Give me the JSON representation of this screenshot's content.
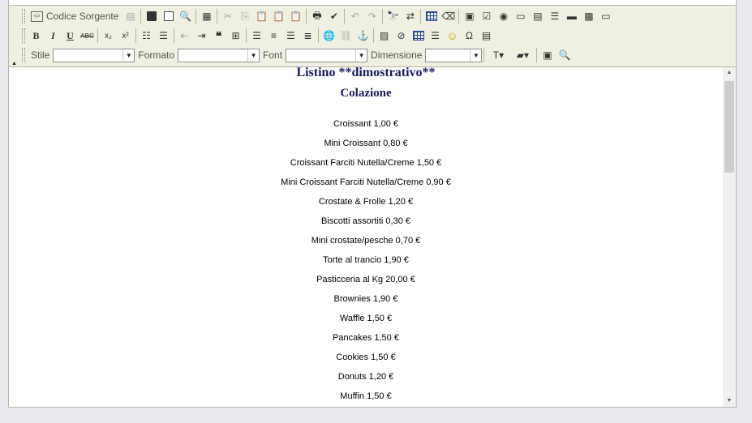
{
  "toolbar": {
    "source_label": "Codice Sorgente",
    "row1_icons": [
      "paste-word-icon",
      "save-icon",
      "new-page-icon",
      "preview-icon",
      "templates-icon",
      "cut-icon",
      "copy-icon",
      "paste-icon",
      "paste-text-icon",
      "paste-word-icon",
      "print-icon",
      "spellcheck-icon",
      "undo-icon",
      "redo-icon",
      "find-icon",
      "replace-icon",
      "select-all-icon",
      "remove-format-icon",
      "form-icon",
      "checkbox-icon",
      "radio-icon",
      "textfield-icon",
      "textarea-icon",
      "select-field-icon",
      "button-field-icon",
      "image-button-icon",
      "hidden-field-icon"
    ],
    "row2_icons": [
      "bold-icon",
      "italic-icon",
      "underline-icon",
      "strikethrough-icon",
      "subscript-icon",
      "superscript-icon",
      "numbered-list-icon",
      "bullet-list-icon",
      "outdent-icon",
      "indent-icon",
      "blockquote-icon",
      "create-div-icon",
      "align-left-icon",
      "align-center-icon",
      "align-right-icon",
      "justify-icon",
      "link-icon",
      "unlink-icon",
      "anchor-icon",
      "image-icon",
      "flash-icon",
      "table-icon",
      "horizontal-rule-icon",
      "smiley-icon",
      "special-char-icon",
      "page-break-icon"
    ],
    "glyphs": {
      "bold": "B",
      "italic": "I",
      "underline": "U",
      "strike": "ABC",
      "sub": "x₂",
      "sup": "x²",
      "anchor": "⚓",
      "smiley": "☺"
    },
    "style_label": "Stile",
    "format_label": "Formato",
    "font_label": "Font",
    "size_label": "Dimensione",
    "style_value": "",
    "format_value": "",
    "font_value": "",
    "size_value": ""
  },
  "document": {
    "title": "Listino **dimostrativo**",
    "subtitle": "Colazione",
    "items": [
      "Croissant 1,00 €",
      "Mini Croissant 0,80 €",
      "Croissant Farciti Nutella/Creme 1,50 €",
      "Mini Croissant Farciti Nutella/Creme 0,90 €",
      "Crostate & Frolle 1,20 €",
      "Biscotti assortiti 0,30 €",
      "Mini crostate/pesche 0,70 €",
      "Torte al trancio 1,90 €",
      "Pasticceria al Kg 20,00 €",
      "Brownies 1,90 €",
      "Waffle 1,50 €",
      "Pancakes 1,50 €",
      "Cookies 1,50 €",
      "Donuts 1,20 €",
      "Muffin 1,50 €"
    ]
  },
  "colors": {
    "toolbar_bg": "#eff0e1",
    "title_color": "#1a1a5e",
    "page_bg": "#e9eaee"
  }
}
